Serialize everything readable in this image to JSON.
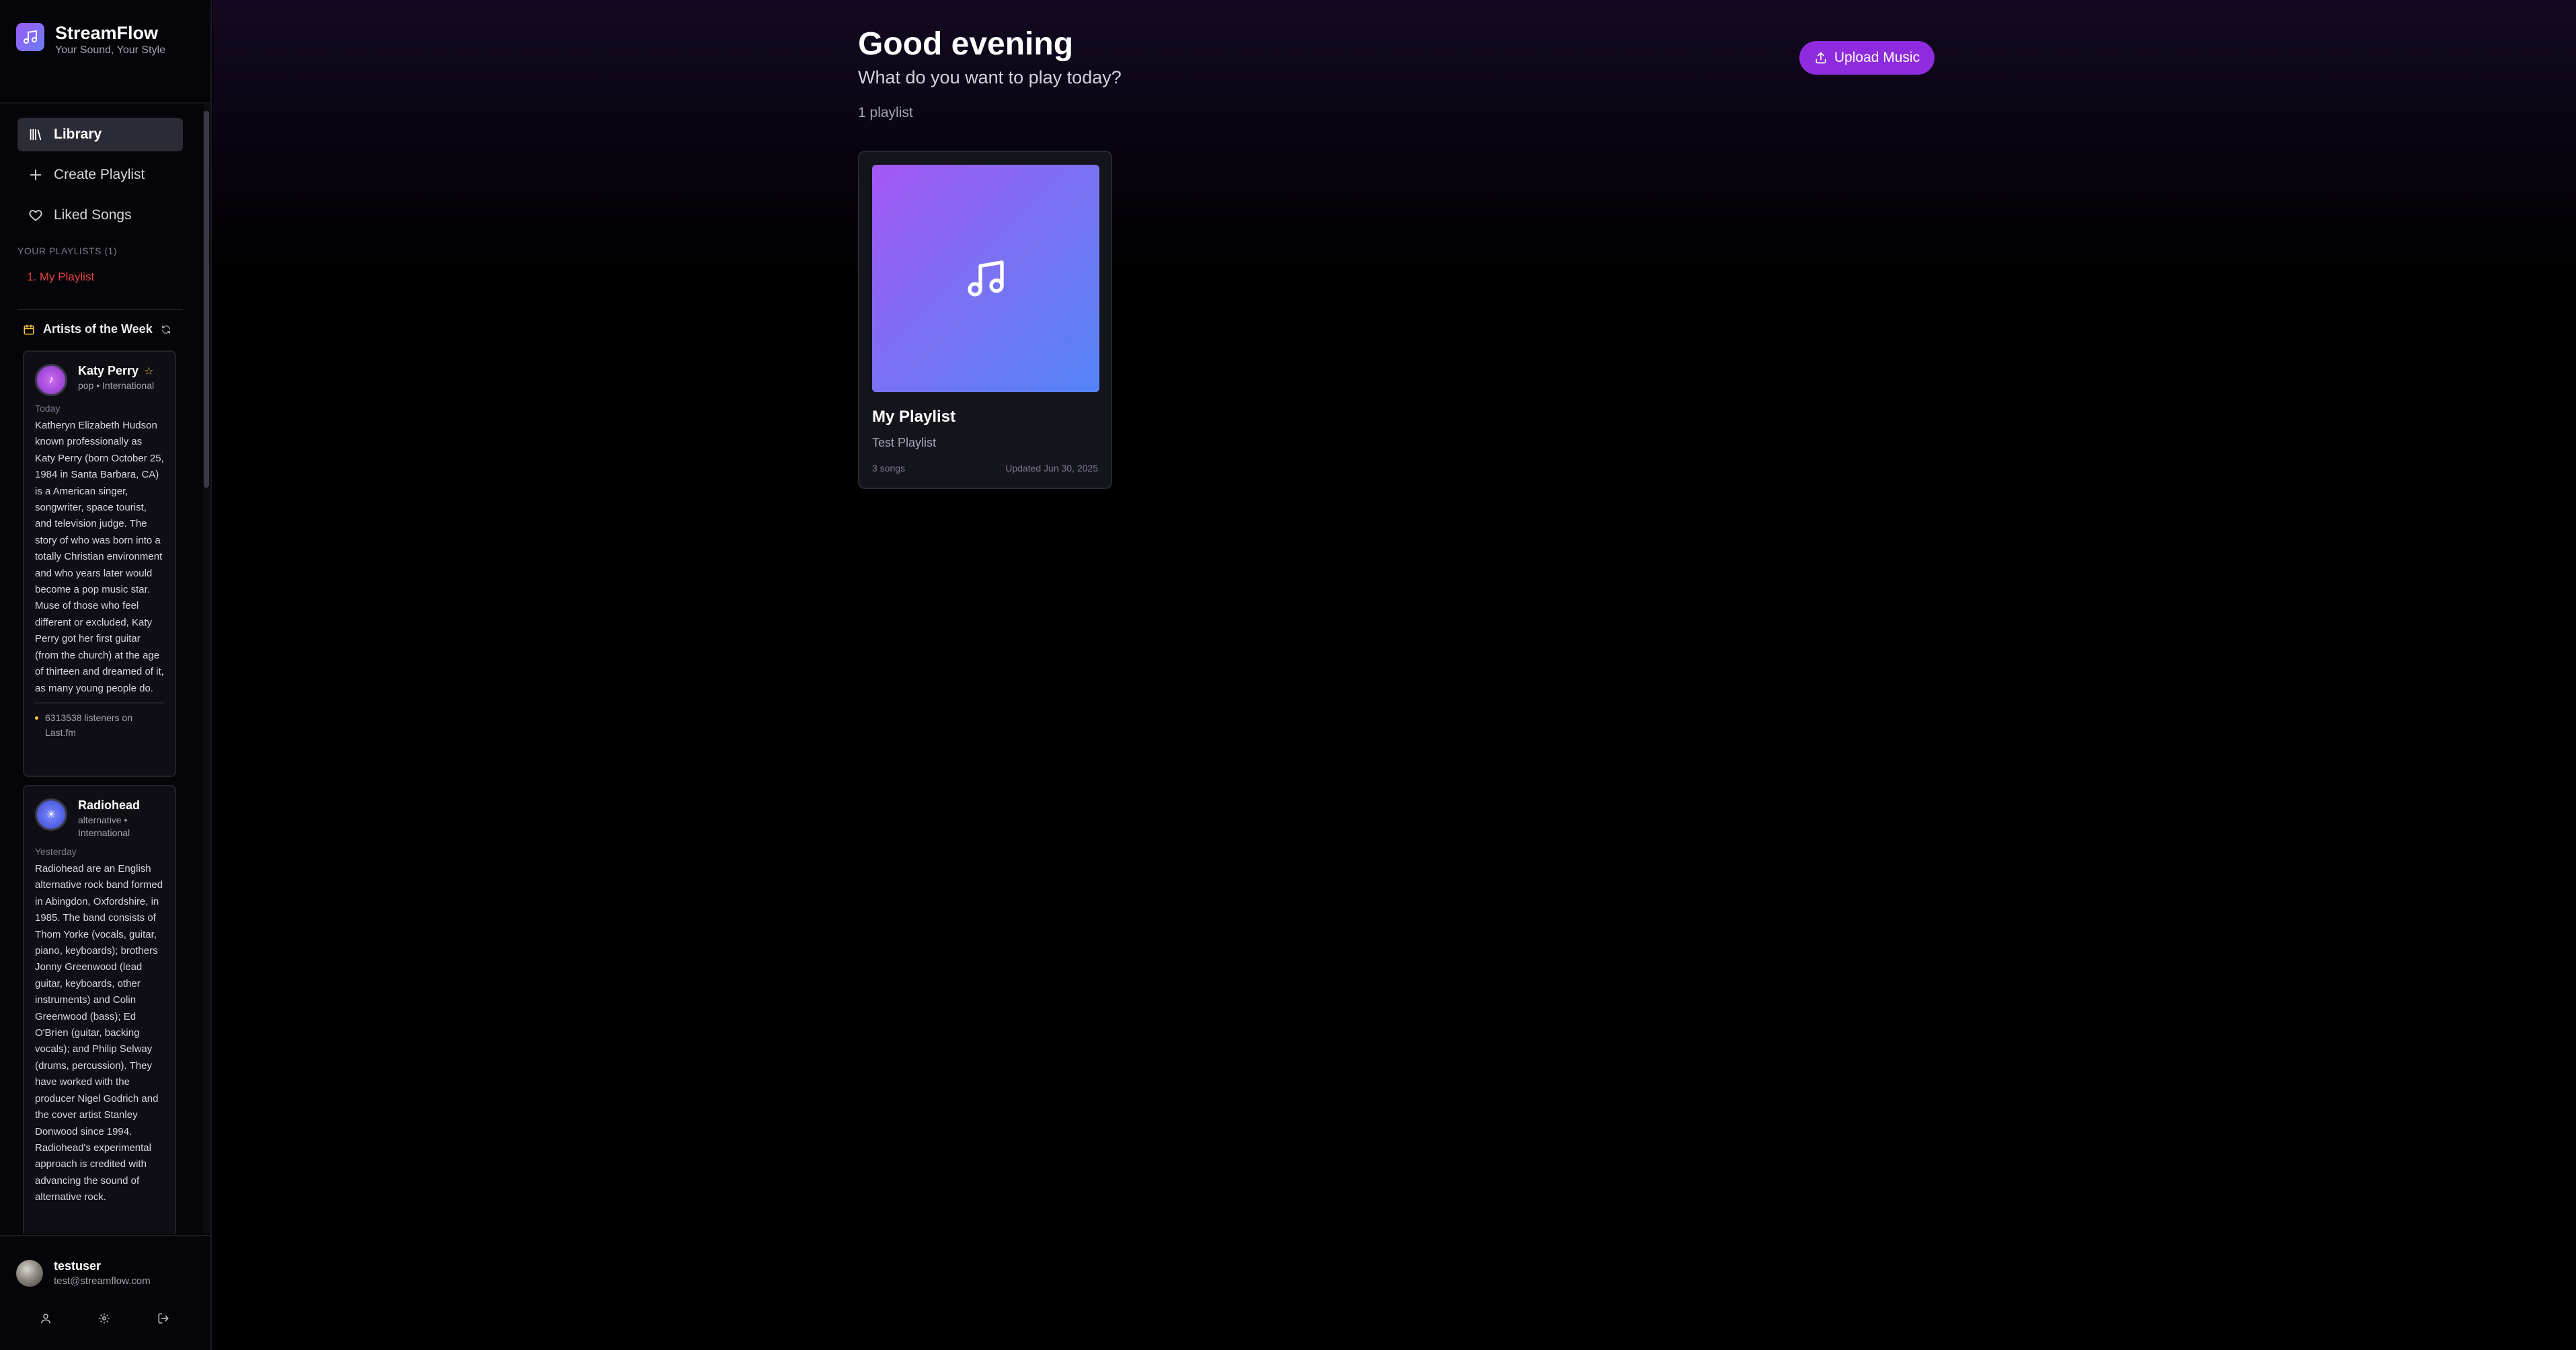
{
  "brand": {
    "name": "StreamFlow",
    "tagline": "Your Sound, Your Style",
    "logo_icon": "music-note-icon"
  },
  "nav": {
    "library": "Library",
    "create_playlist": "Create Playlist",
    "liked_songs": "Liked Songs"
  },
  "sidebar": {
    "playlists_label": "YOUR PLAYLISTS (1)",
    "playlists": [
      "1. My Playlist"
    ],
    "artists_of_week_label": "Artists of the Week"
  },
  "artists": [
    {
      "name": "Katy Perry",
      "genre": "pop • International",
      "when": "Today",
      "bio": "Katheryn Elizabeth Hudson known professionally as Katy Perry (born October 25, 1984 in Santa Barbara, CA) is a American singer, songwriter, space tourist, and television judge. The story of who was born into a totally Christian environment and who years later would become a pop music star. Muse of those who feel different or excluded, Katy Perry got her first guitar (from the church) at the age of thirteen and dreamed of it, as many young people do.",
      "listeners": "6313538 listeners on Last.fm",
      "avatar_glyph": "♪",
      "featured": true
    },
    {
      "name": "Radiohead",
      "genre": "alternative • International",
      "when": "Yesterday",
      "bio": "Radiohead are an English alternative rock band formed in Abingdon, Oxfordshire, in 1985. The band consists of Thom Yorke (vocals, guitar, piano, keyboards); brothers Jonny Greenwood (lead guitar, keyboards, other instruments) and Colin Greenwood (bass); Ed O'Brien (guitar, backing vocals); and Philip Selway (drums, percussion). They have worked with the producer Nigel Godrich and the cover artist Stanley Donwood since 1994. Radiohead's experimental approach is credited with advancing the sound of alternative rock.",
      "avatar_glyph": "☀"
    }
  ],
  "user": {
    "name": "testuser",
    "email": "test@streamflow.com"
  },
  "main": {
    "greeting": "Good evening",
    "subtitle": "What do you want to play today?",
    "playlist_count": "1 playlist",
    "upload_label": "Upload Music"
  },
  "playlist_card": {
    "title": "My Playlist",
    "description": "Test Playlist",
    "songs": "3 songs",
    "updated": "Updated Jun 30, 2025"
  },
  "colors": {
    "accent": "#8f2bde",
    "playlist_link": "#e0443e",
    "cover_gradient_start": "#a458f4",
    "cover_gradient_end": "#5484f6"
  }
}
